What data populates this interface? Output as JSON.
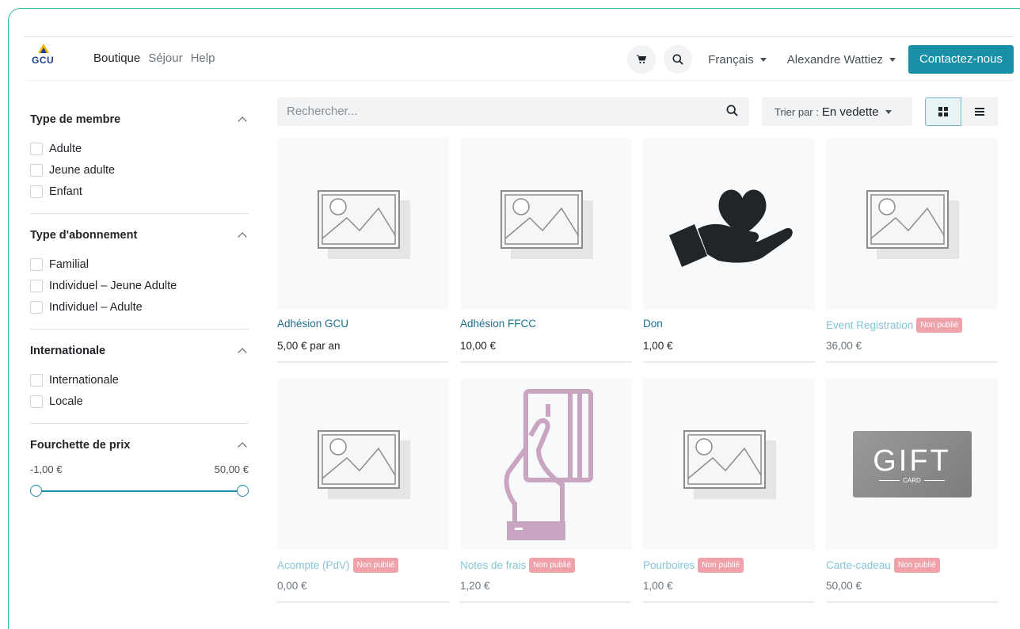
{
  "brand": {
    "logo_text": "GCU"
  },
  "nav": {
    "items": [
      {
        "label": "Boutique"
      },
      {
        "label": "Séjour"
      },
      {
        "label": "Help"
      }
    ]
  },
  "header": {
    "language": "Français",
    "user": "Alexandre Wattiez",
    "contact_label": "Contactez-nous"
  },
  "filters": [
    {
      "title": "Type de membre",
      "options": [
        "Adulte",
        "Jeune adulte",
        "Enfant"
      ]
    },
    {
      "title": "Type d'abonnement",
      "options": [
        "Familial",
        "Individuel – Jeune Adulte",
        "Individuel – Adulte"
      ]
    },
    {
      "title": "Internationale",
      "options": [
        "Internationale",
        "Locale"
      ]
    }
  ],
  "price_range": {
    "title": "Fourchette de prix",
    "min_label": "-1,00 €",
    "max_label": "50,00 €",
    "min": -1.0,
    "max": 50.0
  },
  "search": {
    "placeholder": "Rechercher..."
  },
  "sort": {
    "prefix": "Trier par :",
    "value": "En vedette"
  },
  "products": [
    {
      "name": "Adhésion GCU",
      "price": "5,00 € par an",
      "badge": "",
      "image": "placeholder-image-icon"
    },
    {
      "name": "Adhésion FFCC",
      "price": "10,00 €",
      "badge": "",
      "image": "placeholder-image-icon"
    },
    {
      "name": "Don",
      "price": "1,00 €",
      "badge": "",
      "image": "heart-hand-icon"
    },
    {
      "name": "Event Registration",
      "price": "36,00 €",
      "badge": "Non publié",
      "image": "placeholder-image-icon"
    },
    {
      "name": "Acompte (PdV)",
      "price": "0,00 €",
      "badge": "Non publié",
      "image": "placeholder-image-icon"
    },
    {
      "name": "Notes de frais",
      "price": "1,20 €",
      "badge": "Non publié",
      "image": "card-hand-icon"
    },
    {
      "name": "Pourboires",
      "price": "1,00 €",
      "badge": "Non publié",
      "image": "placeholder-image-icon"
    },
    {
      "name": "Carte-cadeau",
      "price": "50,00 €",
      "badge": "Non publié",
      "image": "gift-card-image",
      "image_text": "GIFT",
      "image_subtext": "CARD"
    }
  ],
  "colors": {
    "accent": "#1a8fa8",
    "link": "#1a6f8f",
    "badge": "#f0a2aa",
    "frame": "#3bb8a4"
  }
}
